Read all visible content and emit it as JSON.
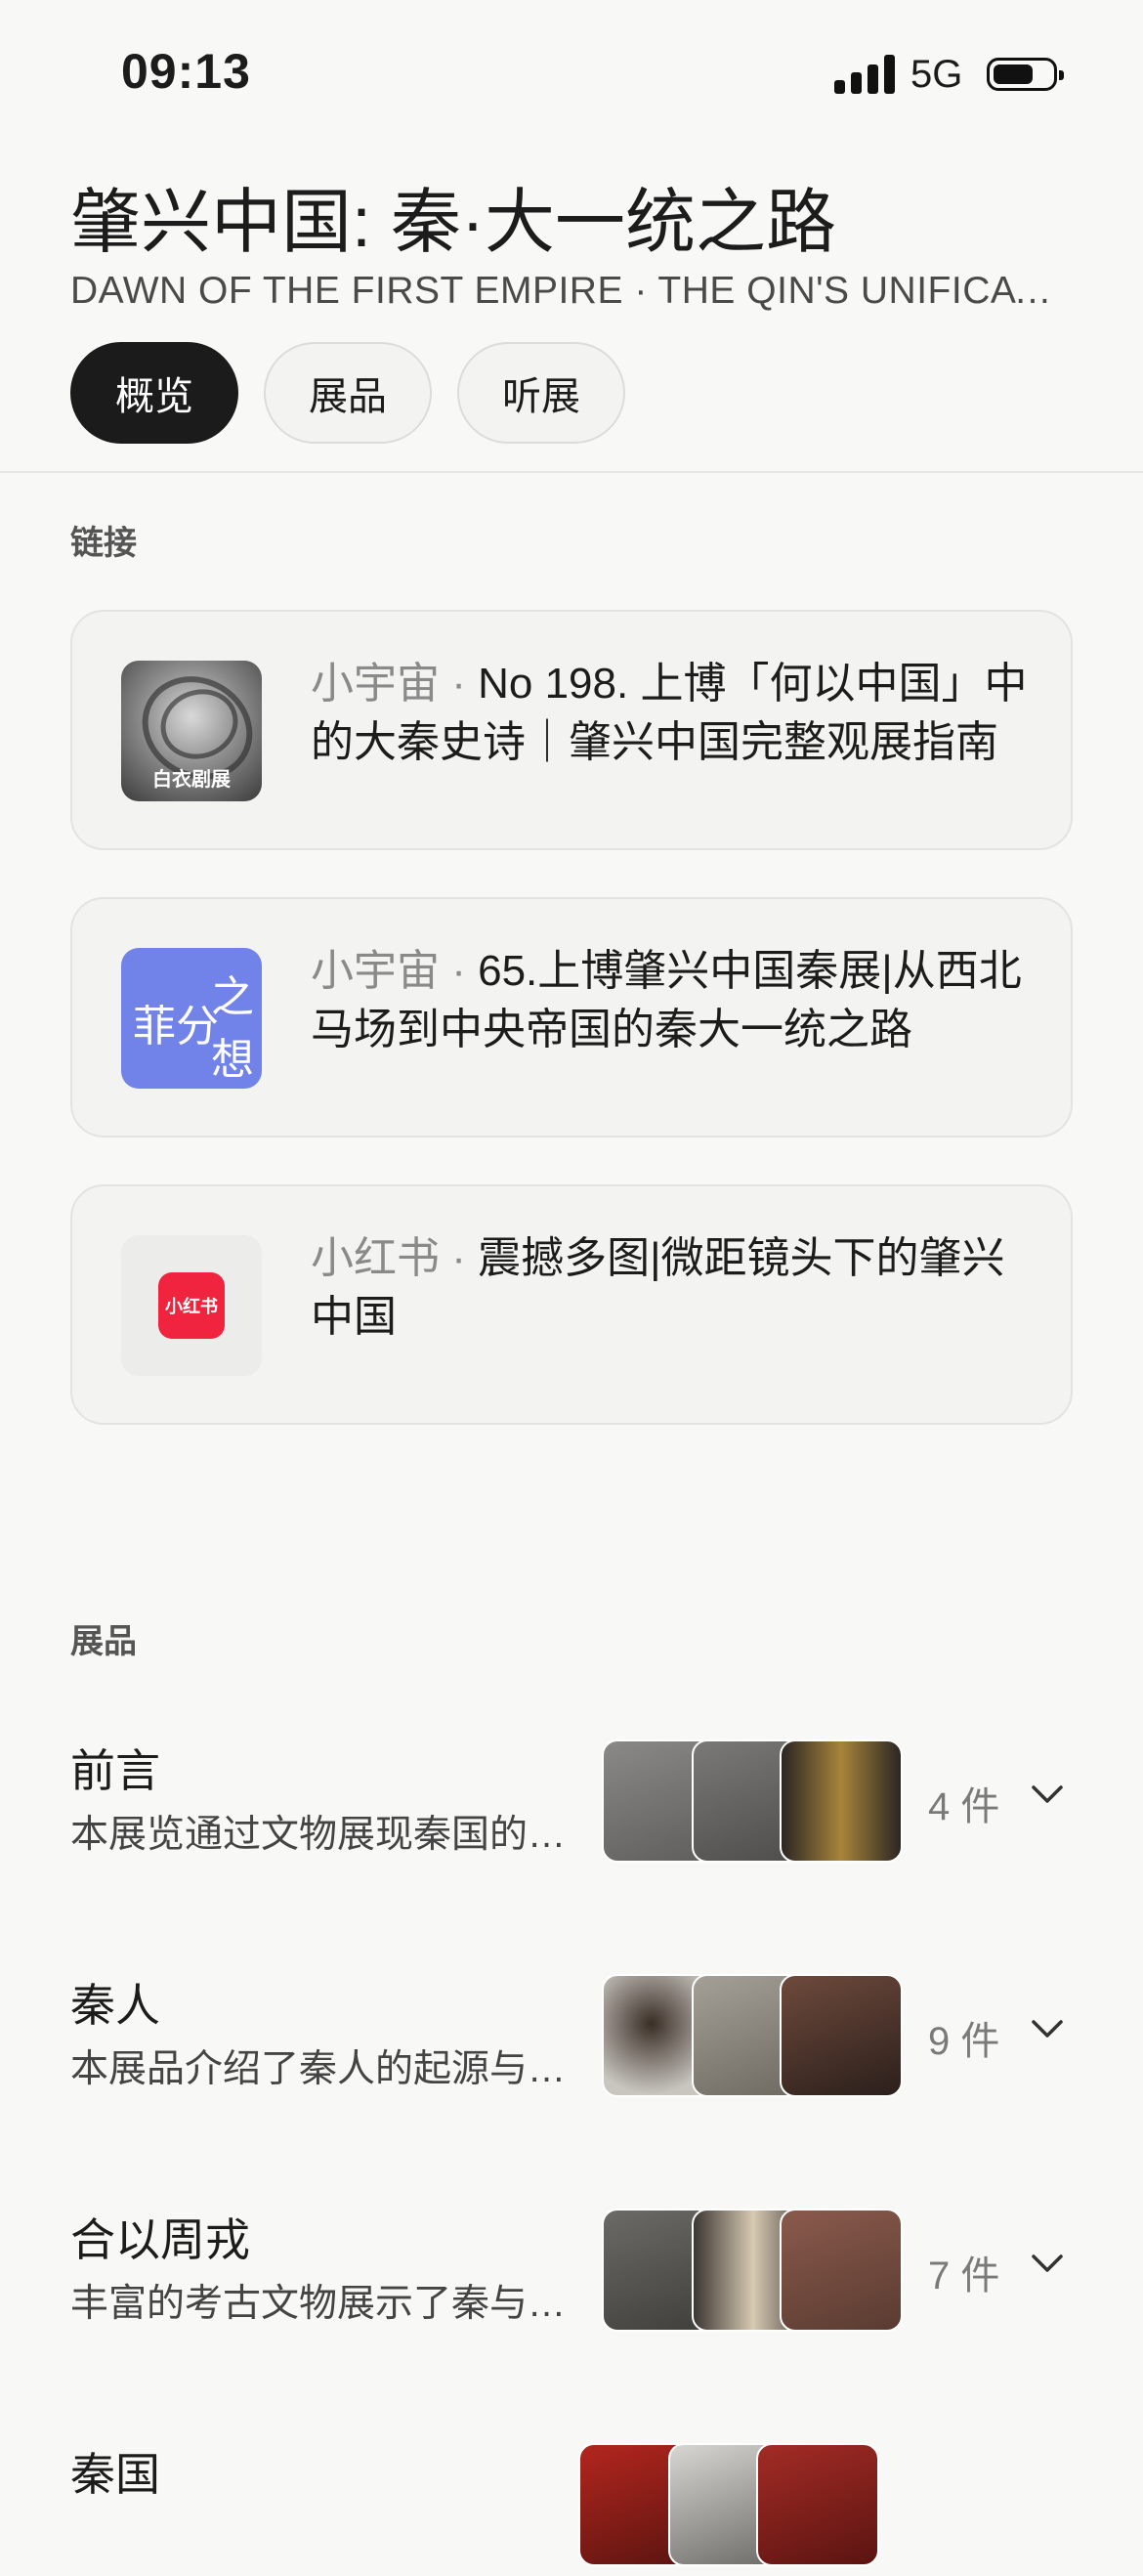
{
  "status_bar": {
    "time": "09:13",
    "network": "5G"
  },
  "header": {
    "title": "肇兴中国: 秦·大一统之路",
    "subtitle": "DAWN OF THE FIRST EMPIRE · THE QIN'S UNIFICATI…"
  },
  "tabs": [
    {
      "label": "概览",
      "active": true
    },
    {
      "label": "展品",
      "active": false
    },
    {
      "label": "听展",
      "active": false
    }
  ],
  "links": {
    "heading": "链接",
    "items": [
      {
        "source": "小宇宙 · ",
        "title": "No 198. 上博「何以中国」中的大秦史诗｜肇兴中国完整观展指南",
        "thumb_caption": "白衣剧展"
      },
      {
        "source": "小宇宙 · ",
        "title": "65.上博肇兴中国秦展|从西北马场到中央帝国的秦大一统之路",
        "thumb_text": [
          "菲分",
          "之",
          "想"
        ]
      },
      {
        "source": "小红书 · ",
        "title": "震撼多图|微距镜头下的肇兴中国",
        "thumb_logo": "小红书"
      }
    ]
  },
  "exhibits": {
    "heading": "展品",
    "items": [
      {
        "title": "前言",
        "desc": "本展览通过文物展现秦国的历史",
        "count": "4 件"
      },
      {
        "title": "秦人",
        "desc": "本展品介绍了秦人的起源与发展",
        "count": "9 件"
      },
      {
        "title": "合以周戎",
        "desc": "丰富的考古文物展示了秦与周戎",
        "count": "7 件"
      },
      {
        "title": "秦国",
        "desc": "",
        "count": ""
      }
    ]
  },
  "colors": {
    "accent_dark": "#1b1b1b",
    "xiaohongshu_red": "#f0243e",
    "podcast_blue": "#7183e8"
  }
}
